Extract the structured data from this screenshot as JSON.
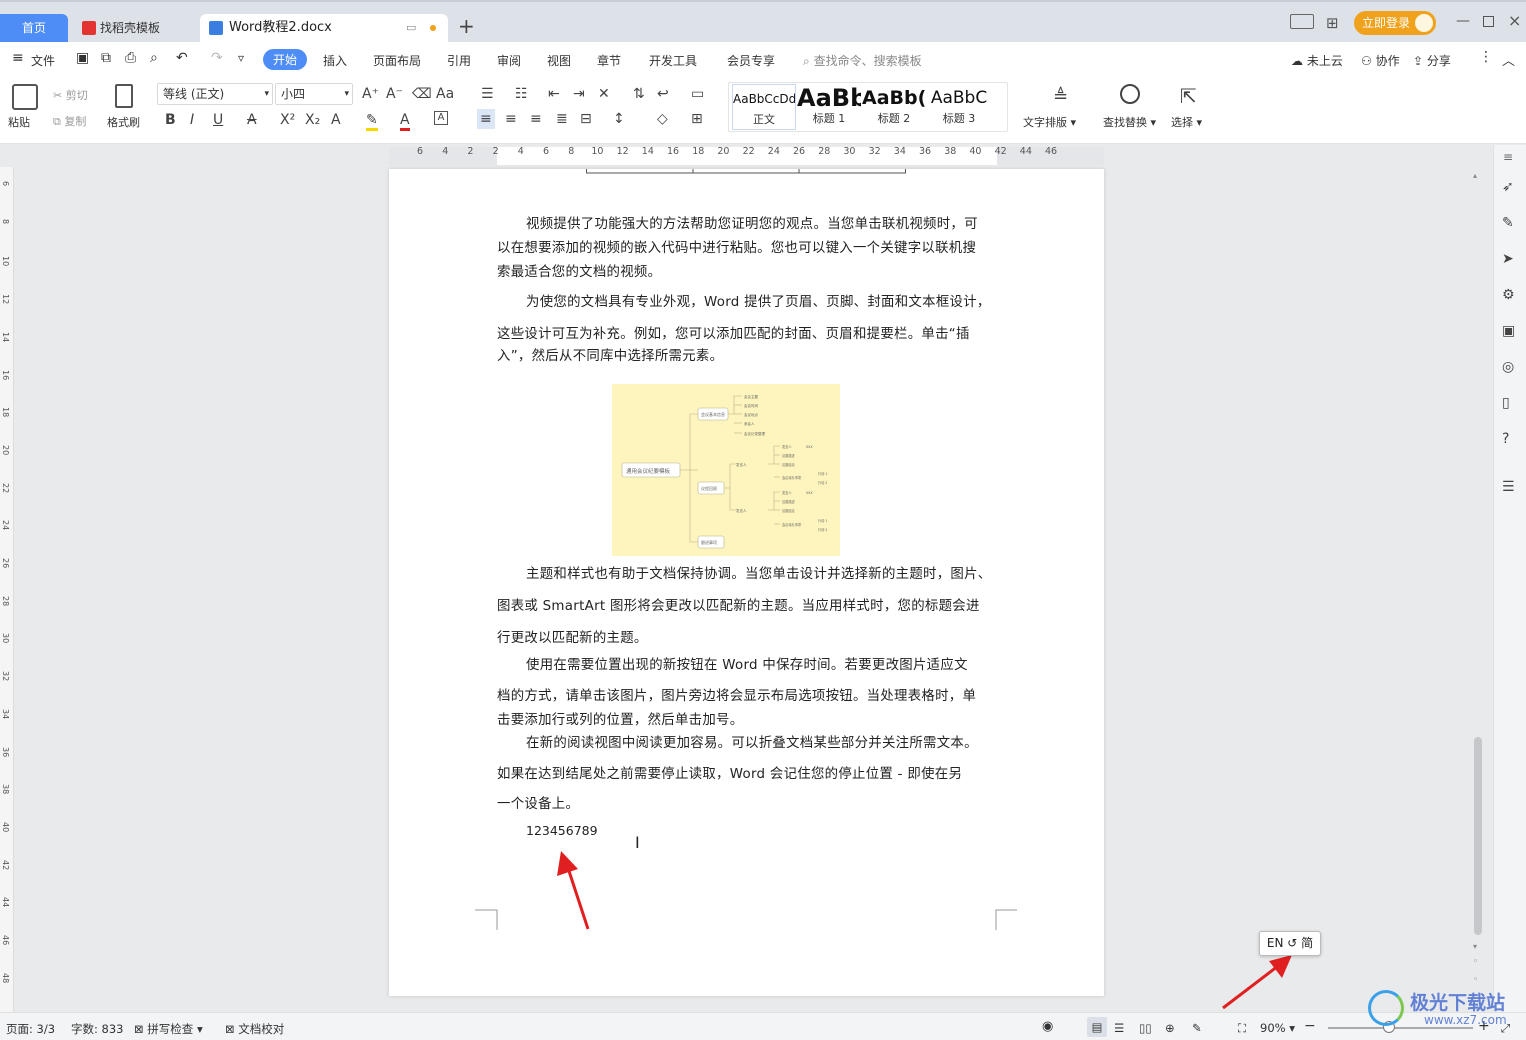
{
  "tabs": {
    "home": "首页",
    "templates": "找稻壳模板",
    "document": "Word教程2.docx"
  },
  "title_bar": {
    "login": "立即登录"
  },
  "menu": {
    "file": "文件",
    "items": [
      "开始",
      "插入",
      "页面布局",
      "引用",
      "审阅",
      "视图",
      "章节",
      "开发工具",
      "会员专享"
    ],
    "search_placeholder": "查找命令、搜索模板",
    "cloud": "未上云",
    "collab": "协作",
    "share": "分享"
  },
  "ribbon": {
    "paste": "粘贴",
    "cut": "剪切",
    "copy": "复制",
    "format_painter": "格式刷",
    "font_name": "等线 (正文)",
    "font_size": "小四",
    "font_case": "Aa",
    "styles": [
      {
        "preview": "AaBbCcDd",
        "name": "正文"
      },
      {
        "preview": "AaBb",
        "name": "标题 1"
      },
      {
        "preview": "AaBb(",
        "name": "标题 2"
      },
      {
        "preview": "AaBbC",
        "name": "标题 3"
      }
    ],
    "text_layout": "文字排版",
    "find_replace": "查找替换",
    "select": "选择"
  },
  "ruler": {
    "ticks": [
      "6",
      "4",
      "2",
      "2",
      "4",
      "6",
      "8",
      "10",
      "12",
      "14",
      "16",
      "18",
      "20",
      "22",
      "24",
      "26",
      "28",
      "30",
      "32",
      "34",
      "36",
      "38",
      "40",
      "42",
      "44",
      "46"
    ]
  },
  "vruler": {
    "ticks": [
      "6",
      "8",
      "10",
      "12",
      "14",
      "16",
      "18",
      "20",
      "22",
      "24",
      "26",
      "28",
      "30",
      "32",
      "34",
      "36",
      "38",
      "40",
      "42",
      "44",
      "46",
      "48"
    ]
  },
  "document": {
    "paragraphs": [
      {
        "lines": [
          "视频提供了功能强大的方法帮助您证明您的观点。当您单击联机视频时，可",
          "以在想要添加的视频的嵌入代码中进行粘贴。您也可以键入一个关键字以联机搜",
          "索最适合您的文档的视频。"
        ]
      },
      {
        "lines": [
          "为使您的文档具有专业外观，Word 提供了页眉、页脚、封面和文本框设计，",
          "这些设计可互为补充。例如，您可以添加匹配的封面、页眉和提要栏。单击“插",
          "入”，然后从不同库中选择所需元素。"
        ]
      },
      {
        "lines": [
          "主题和样式也有助于文档保持协调。当您单击设计并选择新的主题时，图片、",
          "图表或 SmartArt 图形将会更改以匹配新的主题。当应用样式时，您的标题会进",
          "行更改以匹配新的主题。"
        ]
      },
      {
        "lines": [
          "使用在需要位置出现的新按钮在 Word 中保存时间。若要更改图片适应文",
          "档的方式，请单击该图片，图片旁边将会显示布局选项按钮。当处理表格时，单",
          "击要添加行或列的位置，然后单击加号。"
        ]
      },
      {
        "lines": [
          "在新的阅读视图中阅读更加容易。可以折叠文档某些部分并关注所需文本。",
          "如果在达到结尾处之前需要停止读取，Word 会记住您的停止位置 - 即使在另",
          "一个设备上。"
        ]
      }
    ],
    "typed_text": "123456789",
    "mindmap": {
      "root": "通用会议纪要模板",
      "branches": [
        "会议基本信息",
        "议程回顾",
        "跟进事项"
      ],
      "leaves": [
        "会议主题",
        "会议时间",
        "会议地点",
        "参会人",
        "会议记录整理",
        "发言人",
        "议题描述",
        "议题结论",
        "会议待办事项",
        "行动 1",
        "行动 2",
        "XXX"
      ]
    }
  },
  "ime": {
    "label": "EN ↺ 简"
  },
  "status": {
    "page": "页面: 3/3",
    "words": "字数: 833",
    "spell": "拼写检查",
    "proof": "文档校对",
    "zoom": "90%"
  },
  "watermark": {
    "brand": "极光下载站",
    "url": "www.xz7.com"
  },
  "colors": {
    "accent": "#4e8df5",
    "login": "#f0a21c",
    "arrow": "#e02020",
    "mindmap_bg": "#fdf5bd"
  }
}
